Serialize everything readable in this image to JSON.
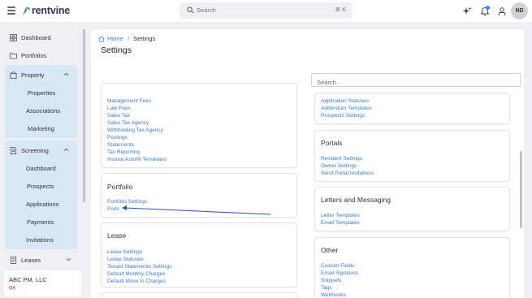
{
  "app": {
    "name": "rentvine",
    "brand_color": "#2e8b57"
  },
  "topbar": {
    "search_placeholder": "Search",
    "search_shortcut": "⌘ K",
    "icons": [
      "sparkle-icon",
      "bell-icon",
      "user-icon"
    ],
    "avatar_initials": "ND"
  },
  "sidebar": {
    "dashboard": "Dashboard",
    "portfolios": "Portfolios",
    "property": {
      "label": "Property",
      "items": [
        "Properties",
        "Associations",
        "Marketing"
      ]
    },
    "screening": {
      "label": "Screening",
      "items": [
        "Dashboard",
        "Prospects",
        "Applications",
        "Payments",
        "Invitations"
      ]
    },
    "leases": "Leases",
    "account": {
      "name": "ABC PM, LLC",
      "env": "QA"
    }
  },
  "breadcrumb": {
    "home": "Home",
    "current": "Settings"
  },
  "page": {
    "title": "Settings",
    "search_placeholder": "Search..."
  },
  "cards": {
    "accounting": {
      "links": [
        "Management Fees",
        "Late Fees",
        "Sales Tax",
        "Sales Tax Agency",
        "Withholding Tax Agency",
        "Postings",
        "Statements",
        "Tax Reporting",
        "Invoice Autofill Templates"
      ]
    },
    "portfolio": {
      "title": "Portfolio",
      "links": [
        "Portfolio Settings",
        "Pods"
      ]
    },
    "lease": {
      "title": "Lease",
      "links": [
        "Lease Settings",
        "Lease Statuses",
        "Tenant Statements Settings",
        "Default Monthly Charges",
        "Default Move In Charges"
      ]
    },
    "screening": {
      "links": [
        "Application Statuses",
        "Addendum Templates",
        "Prospects Settings"
      ]
    },
    "portals": {
      "title": "Portals",
      "links": [
        "Resident Settings",
        "Owner Settings",
        "Send Portal Invitations"
      ]
    },
    "letters": {
      "title": "Letters and Messaging",
      "links": [
        "Letter Templates",
        "Email Templates"
      ]
    },
    "other": {
      "title": "Other",
      "links": [
        "Custom Fields",
        "Email Signature",
        "Snippets",
        "Tags",
        "Webhooks"
      ]
    }
  },
  "colors": {
    "link": "#3a7bd5",
    "annotation_arrow": "#2b4fbf",
    "sidebar_group_bg": "#d7e7f3"
  }
}
